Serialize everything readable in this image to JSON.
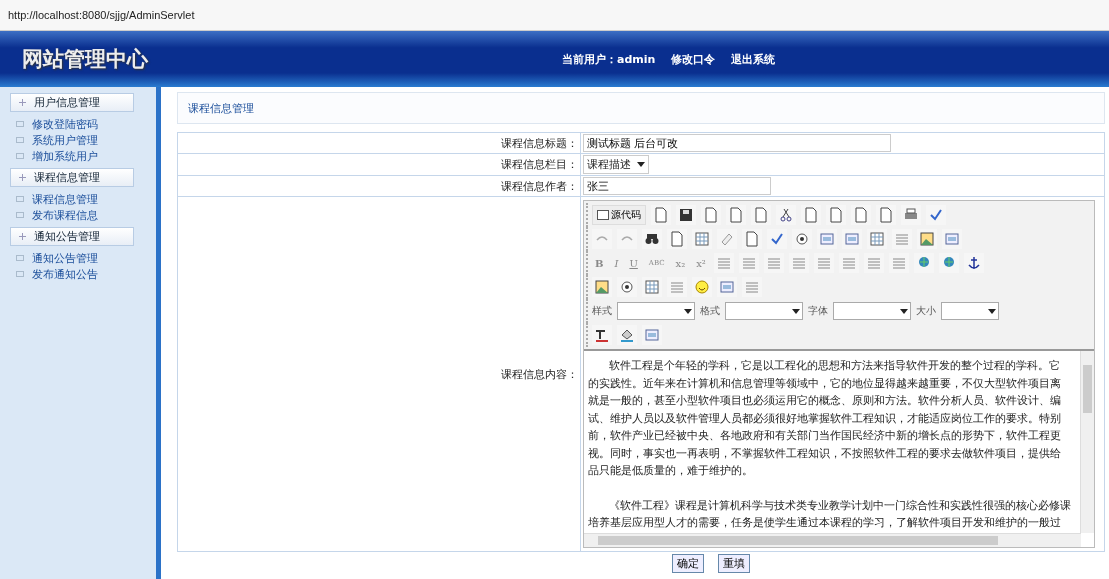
{
  "browser": {
    "url": "http://localhost:8080/sjjg/AdminServlet"
  },
  "header": {
    "logo": "网站管理中心",
    "user_label": "当前用户：",
    "user": "admin",
    "links": [
      "修改口令",
      "退出系统"
    ]
  },
  "sidebar": {
    "groups": [
      {
        "title": "用户信息管理",
        "items": [
          "修改登陆密码",
          "系统用户管理",
          "增加系统用户"
        ]
      },
      {
        "title": "课程信息管理",
        "items": [
          "课程信息管理",
          "发布课程信息"
        ]
      },
      {
        "title": "通知公告管理",
        "items": [
          "通知公告管理",
          "发布通知公告"
        ]
      }
    ]
  },
  "panel": {
    "title": "课程信息管理"
  },
  "form": {
    "title_label": "课程信息标题：",
    "title_value": "测试标题 后台可改",
    "column_label": "课程信息栏目：",
    "column_value": "课程描述",
    "author_label": "课程信息作者：",
    "author_value": "张三",
    "content_label": "课程信息内容："
  },
  "editor": {
    "source_button": "源代码",
    "format_buttons": [
      "B",
      "I",
      "U",
      "ABC"
    ],
    "script_buttons": [
      "x₂",
      "x²"
    ],
    "select_labels": [
      "样式",
      "格式",
      "字体",
      "大小"
    ],
    "paragraphs": [
      [
        "软件工程是个年轻的学科，它是以工程化的思想和方法来指导软件开发的整个过程的学科。它",
        "的实践性。近年来在计算机和信息管理等领域中，它的地位显得越来越重要，不仅大型软件项目离",
        "就是一般的，甚至小型软件项目也必须运用它的概念、原则和方法。软件分析人员、软件设计、编",
        "试、维护人员以及软件管理人员都必须很好地掌握软件工程知识，才能适应岗位工作的要求。特别",
        "前，软件产业已经被中央、各地政府和有关部门当作国民经济中新的增长点的形势下，软件工程更",
        "视。同时，事实也一再表明，不掌握软件工程知识，不按照软件工程的要求去做软件项目，提供给",
        "品只能是低质量的，难于维护的。"
      ],
      [
        "《软件工程》课程是计算机科学与技术类专业教学计划中一门综合性和实践性很强的核心必修课",
        "培养基层应用型人才的需要，任务是使学生通过本课程的学习，了解软件项目开发和维护的一般过"
      ]
    ]
  },
  "buttons": [
    "确定",
    "重填"
  ]
}
